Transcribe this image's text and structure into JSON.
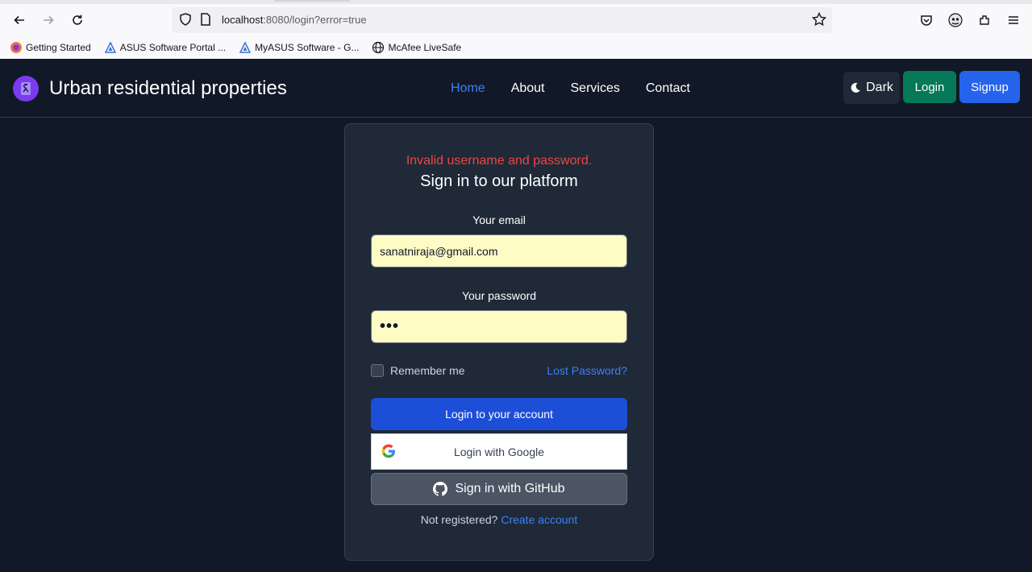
{
  "browser": {
    "url_host": "localhost",
    "url_rest": ":8080/login?error=true",
    "icons": [
      "back-arrow-icon",
      "forward-arrow-icon",
      "reload-icon",
      "shield-icon",
      "page-icon",
      "star-icon",
      "pocket-icon",
      "account-icon",
      "extensions-icon",
      "menu-icon"
    ],
    "bookmarks": [
      {
        "label": "Getting Started",
        "icon": "firefox-icon"
      },
      {
        "label": "ASUS Software Portal ...",
        "icon": "asus-icon"
      },
      {
        "label": "MyASUS Software - G...",
        "icon": "asus-icon"
      },
      {
        "label": "McAfee LiveSafe",
        "icon": "globe-icon"
      }
    ]
  },
  "header": {
    "brand": "Urban residential properties",
    "nav": [
      {
        "label": "Home",
        "active": true
      },
      {
        "label": "About"
      },
      {
        "label": "Services"
      },
      {
        "label": "Contact"
      }
    ],
    "theme_label": "Dark",
    "login_label": "Login",
    "signup_label": "Signup",
    "colors": {
      "bg": "#111827",
      "active": "#3b82f6",
      "login": "#047857",
      "signup": "#2563eb"
    }
  },
  "form": {
    "error": "Invalid username and password.",
    "title": "Sign in to our platform",
    "email_label": "Your email",
    "email_value": "sanatniraja@gmail.com",
    "password_label": "Your password",
    "password_value": "•••",
    "remember_label": "Remember me",
    "lost_password": "Lost Password?",
    "submit_label": "Login to your account",
    "google_label": "Login with Google",
    "github_label": "Sign in with GitHub",
    "register_text": "Not registered?",
    "register_link": "Create account",
    "colors": {
      "error": "#ef4444",
      "input_bg": "#fefbc5",
      "primary": "#1d4ed8",
      "github": "#4b5563"
    }
  }
}
